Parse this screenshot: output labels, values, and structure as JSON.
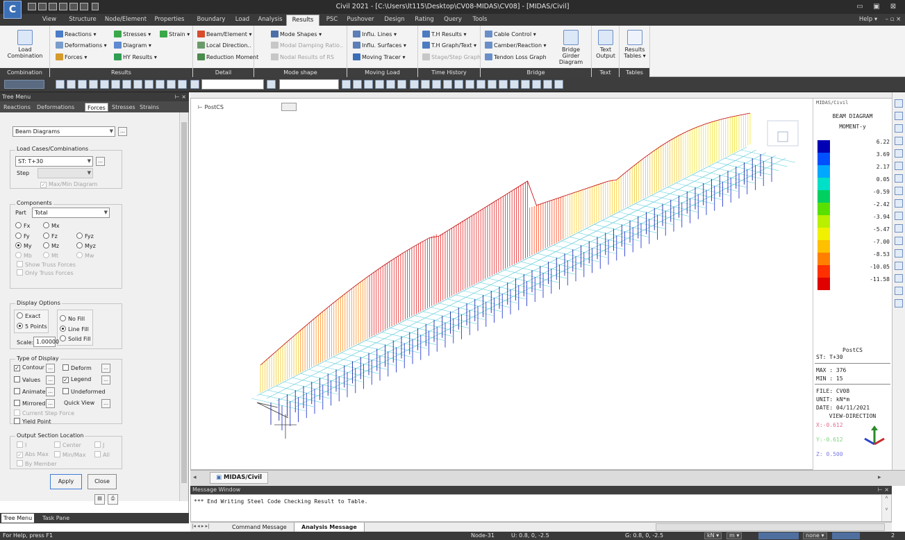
{
  "title": "Civil 2021 - [C:\\Users\\lt115\\Desktop\\CV08-MIDAS\\CV08] - [MIDAS/Civil]",
  "menu": [
    {
      "label": "View"
    },
    {
      "label": "Structure"
    },
    {
      "label": "Node/Element"
    },
    {
      "label": "Properties"
    },
    {
      "label": "Boundary"
    },
    {
      "label": "Load"
    },
    {
      "label": "Analysis"
    },
    {
      "label": "Results",
      "active": true
    },
    {
      "label": "PSC"
    },
    {
      "label": "Pushover"
    },
    {
      "label": "Design"
    },
    {
      "label": "Rating"
    },
    {
      "label": "Query"
    },
    {
      "label": "Tools"
    }
  ],
  "help_label": "Help",
  "ribbon": {
    "combination": {
      "btn1": "Load",
      "btn2": "Combination",
      "group": "Combination"
    },
    "results": {
      "reactions": "Reactions",
      "deformations": "Deformations",
      "forces": "Forces",
      "stresses": "Stresses",
      "diagram": "Diagram",
      "strain": "Strain",
      "hy_results": "HY Results",
      "group": "Results"
    },
    "detail": {
      "beam_element": "Beam/Element",
      "local_direction": "Local Direction..",
      "reduction_moment": "Reduction Moment",
      "group": "Detail"
    },
    "mode_shape": {
      "mode_shapes": "Mode Shapes",
      "modal_damping": "Modal Damping Ratio..",
      "nodal_results": "Nodal Results of RS",
      "group": "Mode shape"
    },
    "moving_load": {
      "influ_lines": "Influ. Lines",
      "influ_surfaces": "Influ. Surfaces",
      "moving_tracer": "Moving Tracer",
      "group": "Moving Load"
    },
    "time_history": {
      "th_results": "T.H Results",
      "th_graph": "T.H Graph/Text",
      "stage_graph": "Stage/Step Graph",
      "group": "Time History"
    },
    "bridge": {
      "cable_control": "Cable Control",
      "camber": "Camber/Reaction",
      "tendon_loss": "Tendon Loss Graph",
      "girder1": "Bridge Girder",
      "girder2": "Diagram",
      "group": "Bridge"
    },
    "text": {
      "btn1": "Text",
      "btn2": "Output",
      "group": "Text"
    },
    "tables": {
      "btn1": "Results",
      "btn2": "Tables",
      "group": "Tables"
    }
  },
  "tree": {
    "title": "Tree Menu",
    "tabs": [
      "Reactions",
      "Deformations",
      "Forces",
      "Stresses",
      "Strains"
    ],
    "active_tab": "Forces",
    "diagram_type": "Beam Diagrams",
    "load_cases_label": "Load Cases/Combinations",
    "load_case": "ST: T+30",
    "step_label": "Step",
    "maxmin": "Max/Min Diagram",
    "components_label": "Components",
    "part_label": "Part",
    "part_value": "Total",
    "comp": {
      "fx": "Fx",
      "mx": "Mx",
      "fy": "Fy",
      "fz": "Fz",
      "fyz": "Fyz",
      "my": "My",
      "mz": "Mz",
      "myz": "Myz",
      "mb": "Mb",
      "mt": "Mt",
      "mw": "Mw"
    },
    "show_truss": "Show Truss Forces",
    "only_truss": "Only Truss Forces",
    "display_options": "Display Options",
    "exact": "Exact",
    "five_points": "5 Points",
    "no_fill": "No Fill",
    "line_fill": "Line Fill",
    "solid_fill": "Solid Fill",
    "scale_label": "Scale:",
    "scale_value": "1.00000",
    "type_label": "Type of Display",
    "contour": "Contour",
    "deform": "Deform",
    "values": "Values",
    "legend": "Legend",
    "animate": "Animate",
    "undeformed": "Undeformed",
    "mirrored": "Mirrored",
    "quickview": "Quick View",
    "current_step": "Current Step Force",
    "yield_point": "Yield Point",
    "output_section": "Output Section Location",
    "osl": {
      "i": "I",
      "center": "Center",
      "j": "J",
      "absmax": "Abs Max",
      "minmax": "Min/Max",
      "all": "All",
      "bymember": "By Member"
    },
    "apply": "Apply",
    "close": "Close",
    "foot_tabs": [
      "Tree Menu",
      "Task Pane"
    ]
  },
  "view": {
    "tab_label": "PostCS",
    "legend": {
      "title": "BEAM DIAGRAM",
      "subtitle": "MOMENT-y",
      "values": [
        "6.22",
        "3.69",
        "2.17",
        "0.05",
        "-0.59",
        "-2.42",
        "-3.94",
        "-5.47",
        "-7.00",
        "-8.53",
        "-10.05",
        "-11.58"
      ],
      "colors": [
        "#0000b4",
        "#0050ff",
        "#00a8ff",
        "#00e0c8",
        "#00d060",
        "#58e000",
        "#b8f000",
        "#f0f000",
        "#ffc000",
        "#ff8000",
        "#ff3000",
        "#e00000"
      ],
      "stage": "PostCS",
      "case": "ST: T+30",
      "max": "MAX : 376",
      "min": "MIN : 15",
      "file": "FILE: CV08",
      "unit": "UNIT: kN*m",
      "date": "DATE: 04/11/2021",
      "view_dir": "VIEW-DIRECTION",
      "vx": "X:-0.612",
      "vy": "Y:-0.612",
      "vz": "Z: 0.500"
    },
    "header_stub": "MIDAS/Civil"
  },
  "doc_tab": "MIDAS/Civil",
  "message": {
    "title": "Message Window",
    "line": "*** End Writing Steel Code Checking Result to Table.",
    "tabs": [
      "Command Message",
      "Analysis Message"
    ]
  },
  "status": {
    "help": "For Help, press F1",
    "node": "Node-31",
    "u": "U: 0.8, 0, -2.5",
    "g": "G: 0.8, 0, -2.5",
    "unit_force": "kN",
    "unit_len": "m",
    "none": "none",
    "page": "2"
  }
}
